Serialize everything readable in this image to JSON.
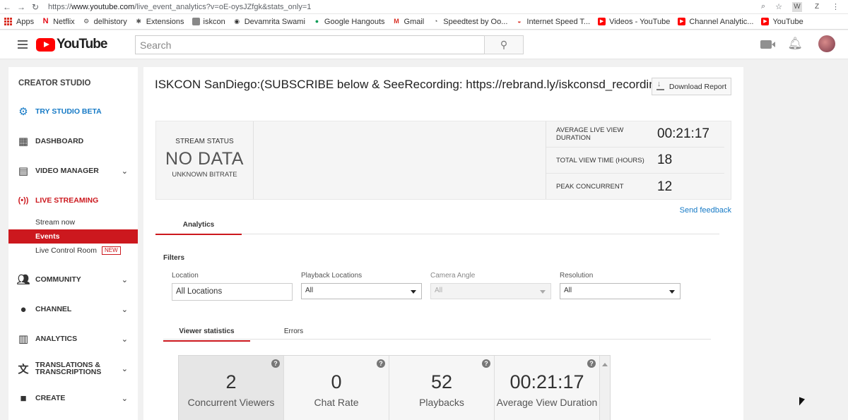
{
  "browser": {
    "url_prefix": "https://",
    "url_host": "www.youtube.com",
    "url_path": "/live_event_analytics?v=oE-oysJZfgk&stats_only=1",
    "ext_w": "W",
    "ext_z": "Z"
  },
  "bookmarks": [
    {
      "label": "Apps",
      "color": "#d93025"
    },
    {
      "label": "Netflix",
      "color": "#e50914",
      "glyph": "N"
    },
    {
      "label": "delhistory",
      "color": "#555555",
      "glyph": "⚙"
    },
    {
      "label": "Extensions",
      "color": "#555555",
      "glyph": "✱"
    },
    {
      "label": "iskcon",
      "color": "#777777",
      "glyph": ""
    },
    {
      "label": "Devamrita Swami",
      "color": "#333333",
      "glyph": "◉"
    },
    {
      "label": "Google Hangouts",
      "color": "#0f9d58",
      "glyph": "●"
    },
    {
      "label": "Gmail",
      "color": "#d93025",
      "glyph": "M"
    },
    {
      "label": "Speedtest by Oo...",
      "color": "#555555",
      "glyph": "◔"
    },
    {
      "label": "Internet Speed T...",
      "color": "#d93025",
      "glyph": "◒"
    },
    {
      "label": "Videos - YouTube",
      "color": "#ff0000",
      "glyph": "▶"
    },
    {
      "label": "Channel Analytic...",
      "color": "#ff0000",
      "glyph": "▶"
    },
    {
      "label": "YouTube",
      "color": "#ff0000",
      "glyph": "▶"
    }
  ],
  "masthead": {
    "logo_text": "YouTube",
    "search_placeholder": "Search"
  },
  "sidebar": {
    "title": "CREATOR STUDIO",
    "try_beta": "TRY STUDIO BETA",
    "dashboard": "DASHBOARD",
    "video_manager": "VIDEO MANAGER",
    "live_streaming": "LIVE STREAMING",
    "stream_now": "Stream now",
    "events": "Events",
    "live_control_room": "Live Control Room",
    "new_badge": "NEW",
    "community": "COMMUNITY",
    "channel": "CHANNEL",
    "analytics": "ANALYTICS",
    "translations_1": "TRANSLATIONS &",
    "translations_2": "TRANSCRIPTIONS",
    "create": "CREATE"
  },
  "main": {
    "title": "ISKCON SanDiego:(SUBSCRIBE below & SeeRecording: https://rebrand.ly/iskconsd_recordings)",
    "download_report": "Download Report",
    "stream_status_label": "STREAM STATUS",
    "stream_status_value": "NO DATA",
    "bitrate": "UNKNOWN BITRATE",
    "metrics": [
      {
        "label": "AVERAGE LIVE VIEW DURATION",
        "value": "00:21:17"
      },
      {
        "label": "TOTAL VIEW TIME (HOURS)",
        "value": "18"
      },
      {
        "label": "PEAK CONCURRENT",
        "value": "12"
      }
    ],
    "send_feedback": "Send feedback",
    "tab_analytics": "Analytics",
    "filters_title": "Filters",
    "filters": {
      "location_label": "Location",
      "location_value": "All Locations",
      "playback_label": "Playback Locations",
      "playback_value": "All",
      "camera_label": "Camera Angle",
      "camera_value": "All",
      "resolution_label": "Resolution",
      "resolution_value": "All"
    },
    "tab_viewer_stats": "Viewer statistics",
    "tab_errors": "Errors",
    "stats": [
      {
        "value": "2",
        "label": "Concurrent Viewers"
      },
      {
        "value": "0",
        "label": "Chat Rate"
      },
      {
        "value": "52",
        "label": "Playbacks"
      },
      {
        "value": "00:21:17",
        "label": "Average View Duration"
      }
    ]
  }
}
